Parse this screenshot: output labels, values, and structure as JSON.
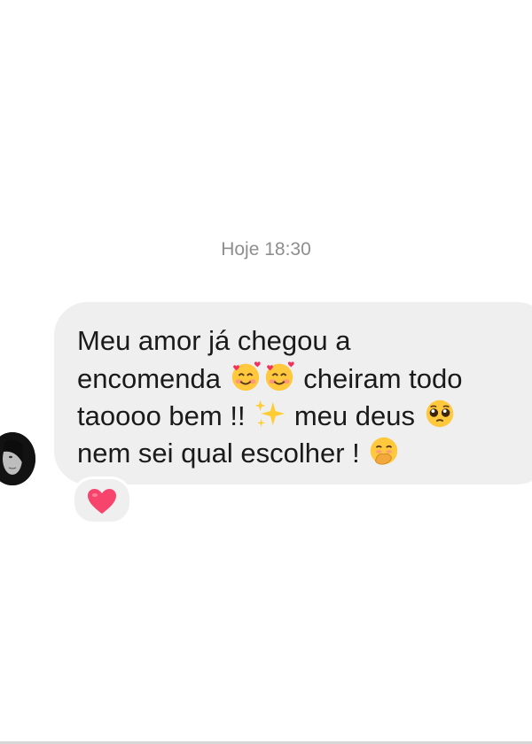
{
  "chat": {
    "timestamp": "Hoje 18:30",
    "message": {
      "lines": [
        "Meu amor já chegou a",
        "encomenda",
        "cheiram todo",
        "taoooo bem !!",
        "meu deus",
        "nem sei qual escolher !"
      ],
      "emojis": [
        "smiling-face-with-hearts",
        "smiling-face-with-hearts",
        "sparkles",
        "pleading-face",
        "face-with-hand-over-mouth"
      ]
    },
    "reaction": {
      "icon": "red-heart",
      "color": "#f7446c"
    }
  },
  "colors": {
    "bubble": "#efefef",
    "timestamp_text": "#8e8e8e",
    "message_text": "#1a1a1a"
  }
}
